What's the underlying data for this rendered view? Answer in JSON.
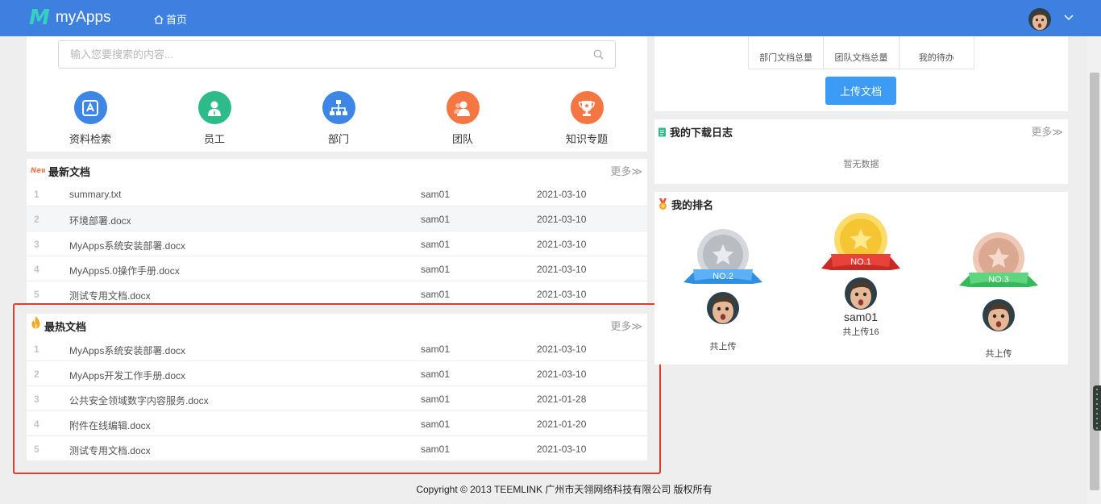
{
  "header": {
    "logo_text": "myApps",
    "nav_home": "首页"
  },
  "search": {
    "placeholder": "输入您要搜索的内容..."
  },
  "quick_links": [
    {
      "label": "资料检索",
      "icon": "search-doc-icon",
      "color": "#3d86e6"
    },
    {
      "label": "员工",
      "icon": "person-icon",
      "color": "#2dbb8a"
    },
    {
      "label": "部门",
      "icon": "org-chart-icon",
      "color": "#3d86e6"
    },
    {
      "label": "团队",
      "icon": "team-icon",
      "color": "#f47643"
    },
    {
      "label": "知识专题",
      "icon": "trophy-icon",
      "color": "#f47643"
    }
  ],
  "latest": {
    "title": "最新文档",
    "more": "更多≫",
    "rows": [
      {
        "num": "1",
        "name": "summary.txt",
        "author": "sam01",
        "date": "2021-03-10"
      },
      {
        "num": "2",
        "name": "环境部署.docx",
        "author": "sam01",
        "date": "2021-03-10"
      },
      {
        "num": "3",
        "name": "MyApps系统安装部署.docx",
        "author": "sam01",
        "date": "2021-03-10"
      },
      {
        "num": "4",
        "name": "MyApps5.0操作手册.docx",
        "author": "sam01",
        "date": "2021-03-10"
      },
      {
        "num": "5",
        "name": "测试专用文档.docx",
        "author": "sam01",
        "date": "2021-03-10"
      }
    ]
  },
  "hottest": {
    "title": "最热文档",
    "more": "更多≫",
    "rows": [
      {
        "num": "1",
        "name": "MyApps系统安装部署.docx",
        "author": "sam01",
        "date": "2021-03-10"
      },
      {
        "num": "2",
        "name": "MyApps开发工作手册.docx",
        "author": "sam01",
        "date": "2021-03-10"
      },
      {
        "num": "3",
        "name": "公共安全领域数字内容服务.docx",
        "author": "sam01",
        "date": "2021-01-28"
      },
      {
        "num": "4",
        "name": "附件在线编辑.docx",
        "author": "sam01",
        "date": "2021-01-20"
      },
      {
        "num": "5",
        "name": "测试专用文档.docx",
        "author": "sam01",
        "date": "2021-03-10"
      }
    ]
  },
  "stats": {
    "items": [
      "部门文档总量",
      "团队文档总量",
      "我的待办"
    ],
    "upload_label": "上传文档"
  },
  "download_log": {
    "title": "我的下载日志",
    "more": "更多≫",
    "empty": "暂无数据"
  },
  "ranking": {
    "title": "我的排名",
    "no1": {
      "badge": "NO.1",
      "name": "sam01",
      "text": "共上传16"
    },
    "no2": {
      "badge": "NO.2",
      "text": "共上传"
    },
    "no3": {
      "badge": "NO.3",
      "text": "共上传"
    }
  },
  "footer": {
    "copyright": "Copyright © 2013 TEEMLINK 广州市天翎网络科技有限公司 版权所有"
  },
  "colors": {
    "header": "#3d80e0",
    "button": "#3b9bf5",
    "highlight_frame": "#e23a2f",
    "gold": "#f6c533",
    "silver": "#b8bcc3",
    "bronze": "#dba891"
  }
}
